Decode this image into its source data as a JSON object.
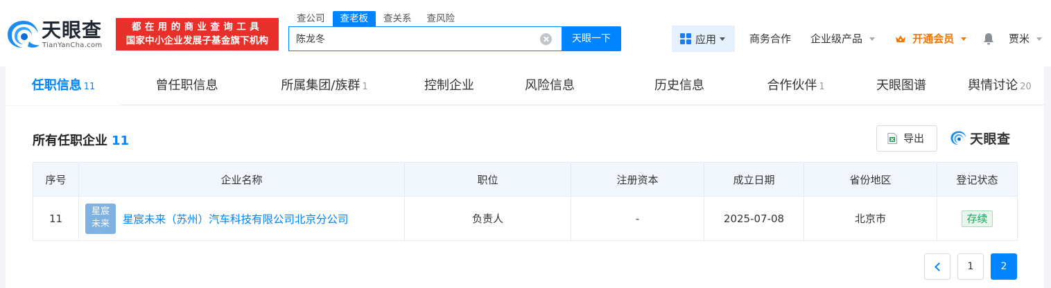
{
  "header": {
    "logo_cn": "天眼查",
    "logo_en": "TianYanCha.com",
    "slogan_line1": "都在用的商业查询工具",
    "slogan_line2": "国家中小企业发展子基金旗下机构",
    "search_tabs": [
      "查公司",
      "查老板",
      "查关系",
      "查风险"
    ],
    "search_value": "陈龙冬",
    "search_button": "天眼一下",
    "app_label": "应用",
    "business_label": "商务合作",
    "enterprise_label": "企业级产品",
    "vip_label": "开通会员",
    "user_name": "贾米"
  },
  "tabs": [
    {
      "label": "任职信息",
      "count": "11"
    },
    {
      "label": "曾任职信息",
      "count": ""
    },
    {
      "label": "所属集团/族群",
      "count": "1"
    },
    {
      "label": "控制企业",
      "count": ""
    },
    {
      "label": "风险信息",
      "count": ""
    },
    {
      "label": "历史信息",
      "count": ""
    },
    {
      "label": "合作伙伴",
      "count": "1"
    },
    {
      "label": "天眼图谱",
      "count": ""
    },
    {
      "label": "舆情讨论",
      "count": "20"
    }
  ],
  "section": {
    "title": "所有任职企业",
    "count": "11",
    "export_label": "导出",
    "brand": "天眼查"
  },
  "table": {
    "headers": [
      "序号",
      "企业名称",
      "职位",
      "注册资本",
      "成立日期",
      "省份地区",
      "登记状态"
    ],
    "rows": [
      {
        "index": "11",
        "avatar_line1": "星宸",
        "avatar_line2": "未来",
        "company": "星宸未来（苏州）汽车科技有限公司北京分公司",
        "position": "负责人",
        "capital": "-",
        "founded": "2025-07-08",
        "region": "北京市",
        "status": "存续"
      }
    ]
  },
  "pagination": {
    "pages": [
      "1",
      "2"
    ],
    "current": "2"
  },
  "colors": {
    "brand_blue": "#0084ff",
    "slogan_red": "#e8302b",
    "vip_orange": "#f27500",
    "status_green": "#19a35a"
  }
}
